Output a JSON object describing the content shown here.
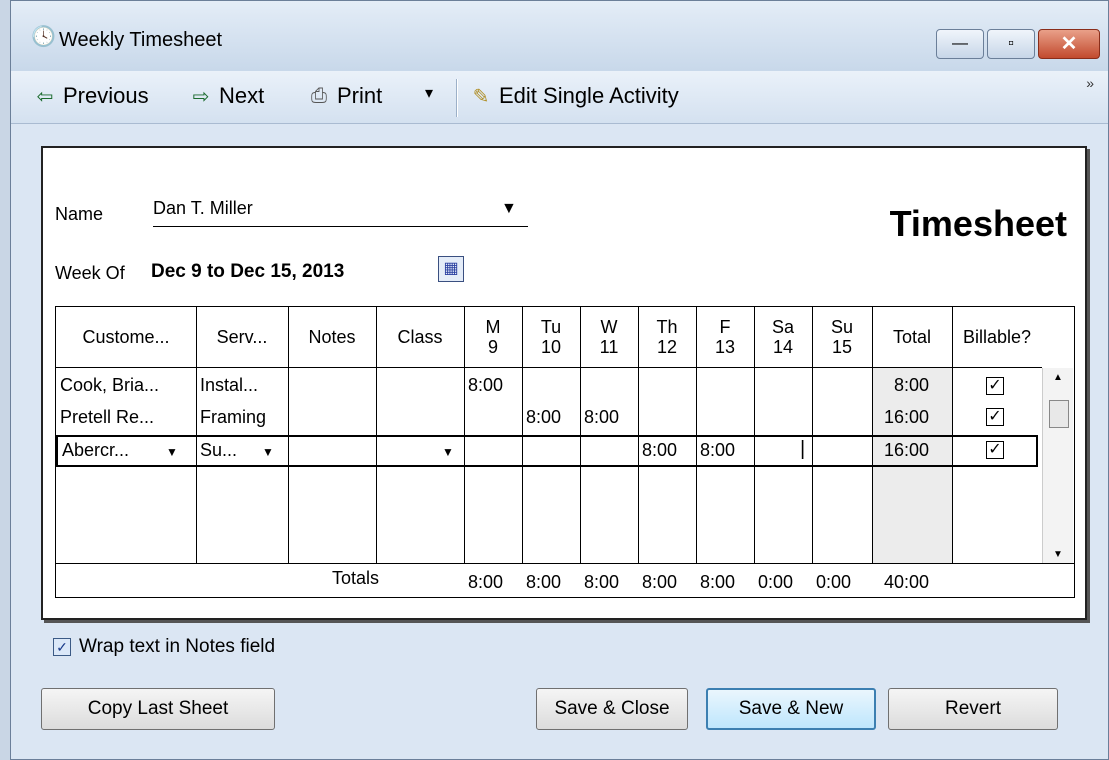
{
  "window": {
    "title": "Weekly Timesheet",
    "minimize": "—",
    "maximize": "▫",
    "close": "✕"
  },
  "toolbar": {
    "previous": "Previous",
    "next": "Next",
    "print": "Print",
    "print_dd": "▾",
    "edit": "Edit Single Activity",
    "overflow": "»"
  },
  "form": {
    "name_label": "Name",
    "name_value": "Dan T. Miller",
    "title": "Timesheet",
    "week_label": "Week Of",
    "week_value": "Dec 9 to Dec 15, 2013"
  },
  "table": {
    "headers": [
      "Custome...",
      "Serv...",
      "Notes",
      "Class",
      "M\n9",
      "Tu\n10",
      "W\n11",
      "Th\n12",
      "F\n13",
      "Sa\n14",
      "Su\n15",
      "Total",
      "Billable?"
    ],
    "rows": [
      {
        "customer": "Cook, Bria...",
        "service": "Instal...",
        "notes": "",
        "class": "",
        "m": "8:00",
        "tu": "",
        "w": "",
        "th": "",
        "f": "",
        "sa": "",
        "su": "",
        "total": "8:00",
        "billable": true
      },
      {
        "customer": "Pretell Re...",
        "service": "Framing",
        "notes": "",
        "class": "",
        "m": "",
        "tu": "8:00",
        "w": "8:00",
        "th": "",
        "f": "",
        "sa": "",
        "su": "",
        "total": "16:00",
        "billable": true
      },
      {
        "customer": "Abercr...",
        "service": "Su...",
        "notes": "",
        "class": "",
        "m": "",
        "tu": "",
        "w": "",
        "th": "8:00",
        "f": "8:00",
        "sa": "",
        "su": "",
        "total": "16:00",
        "billable": true
      }
    ],
    "totals_label": "Totals",
    "totals": [
      "8:00",
      "8:00",
      "8:00",
      "8:00",
      "8:00",
      "0:00",
      "0:00",
      "40:00"
    ]
  },
  "wrap_notes": {
    "label": "Wrap text in Notes field",
    "checked": true
  },
  "buttons": {
    "copy_last": "Copy Last Sheet",
    "save_close": "Save & Close",
    "save_new": "Save & New",
    "revert": "Revert"
  }
}
